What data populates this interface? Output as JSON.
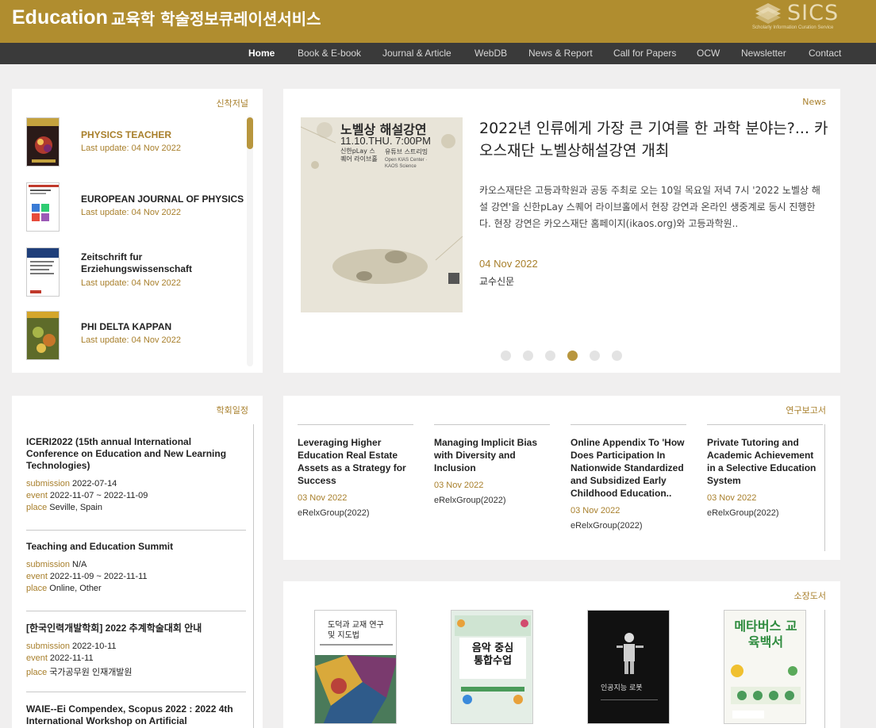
{
  "header": {
    "brand": "Education",
    "subtitle": "교육학 학술정보큐레이션서비스",
    "logo_text": "SICS",
    "logo_tagline": "Scholarly Information Curation Service"
  },
  "nav": {
    "items": [
      "Home",
      "Book & E-book",
      "Journal & Article",
      "WebDB",
      "News & Report",
      "Call for Papers",
      "OCW",
      "Newsletter",
      "Contact"
    ],
    "active": "Home"
  },
  "new_journals": {
    "title": "신착저널",
    "items": [
      {
        "title": "PHYSICS TEACHER",
        "update": "Last update: 04 Nov 2022",
        "highlighted": true
      },
      {
        "title": "EUROPEAN JOURNAL OF PHYSICS",
        "update": "Last update: 04 Nov 2022"
      },
      {
        "title": "Zeitschrift fur Erziehungswissenschaft",
        "update": "Last update: 04 Nov 2022"
      },
      {
        "title": "PHI DELTA KAPPAN",
        "update": "Last update: 04 Nov 2022"
      }
    ]
  },
  "news": {
    "label": "News",
    "title": "2022년 인류에게 가장 큰 기여를 한 과학 분야는?... 카오스재단 노벨상해설강연 개최",
    "body": "카오스재단은 고등과학원과 공동 주최로 오는 10일 목요일 저녁 7시 '2022 노벨상 해설 강연'을 신한pLay 스퀘어 라이브홀에서 현장 강연과 온라인 생중계로 동시 진행한다. 현장 강연은 카오스재단 홈페이지(ikaos.org)와 고등과학원..",
    "date": "04 Nov 2022",
    "source": "교수신문",
    "poster": {
      "headline": "노벨상 해설강연",
      "datetime": "11.10.THU. 7:00PM",
      "venue": "신한pLay 스퀘어 라이브홀",
      "stream": "유튜브 스트리밍",
      "orgs": "Open KIAS Center · KAOS Science"
    },
    "dot_count": 6,
    "active_dot": 3
  },
  "events": {
    "title": "학회일정",
    "items": [
      {
        "title": "ICERI2022 (15th annual International Conference on Education and New Learning Technologies)",
        "submission": "2022-07-14",
        "event": "2022-11-07 ~ 2022-11-09",
        "place": "Seville, Spain"
      },
      {
        "title": "Teaching and Education Summit",
        "submission": "N/A",
        "event": "2022-11-09 ~ 2022-11-11",
        "place": "Online, Other"
      },
      {
        "title": "[한국인력개발학회] 2022 추계학술대회 안내",
        "submission": "2022-10-11",
        "event": "2022-11-11",
        "place": "국가공무원 인재개발원"
      },
      {
        "title": "WAIE--Ei Compendex, Scopus 2022 : 2022 4th International Workshop on Artificial"
      }
    ],
    "labels": {
      "submission": "submission",
      "event": "event",
      "place": "place"
    }
  },
  "reports": {
    "title": "연구보고서",
    "items": [
      {
        "title": "Leveraging Higher Education Real Estate Assets as a Strategy for Success",
        "date": "03 Nov 2022",
        "source": "eRelxGroup(2022)"
      },
      {
        "title": "Managing Implicit Bias with Diversity and Inclusion",
        "date": "03 Nov 2022",
        "source": "eRelxGroup(2022)"
      },
      {
        "title": "Online Appendix To 'How Does Participation In Nationwide Standardized and Subsidized Early Childhood Education..",
        "date": "03 Nov 2022",
        "source": "eRelxGroup(2022)"
      },
      {
        "title": "Private Tutoring and Academic Achievement in a Selective Education System",
        "date": "03 Nov 2022",
        "source": "eRelxGroup(2022)"
      }
    ]
  },
  "library": {
    "title": "소장도서",
    "books": [
      {
        "cover_title": "도덕과 교재 연구 및 지도법",
        "theme": "colorful-abstract"
      },
      {
        "cover_title": "음악 중심 통합수업",
        "theme": "green-illustration"
      },
      {
        "cover_title": "인공지능 로봇",
        "theme": "black-robot"
      },
      {
        "cover_title": "메타버스 교육백서",
        "theme": "green-metaverse"
      }
    ]
  },
  "colors": {
    "header": "#b08d2f",
    "nav": "#3a3a3a",
    "accent": "#a87f2b",
    "background": "#f0efef"
  }
}
